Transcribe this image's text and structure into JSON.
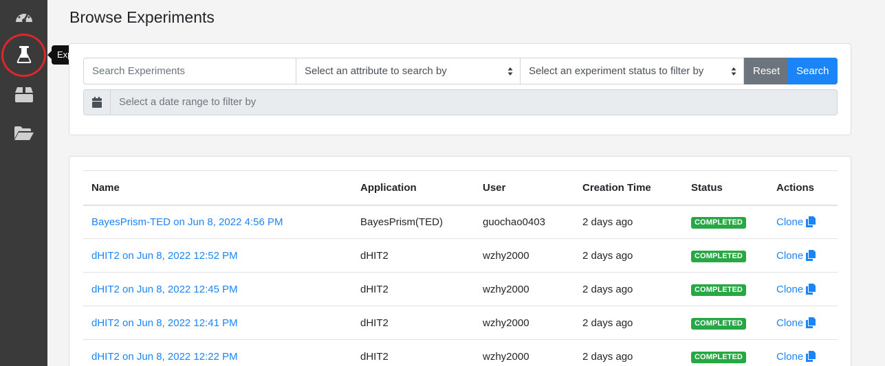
{
  "sidebar": {
    "items": [
      {
        "icon": "dashboard-gauge-icon"
      },
      {
        "icon": "flask-icon",
        "active": true
      },
      {
        "icon": "box-icon"
      },
      {
        "icon": "folder-open-icon"
      }
    ],
    "tooltip": "Experiments"
  },
  "page": {
    "title": "Browse Experiments"
  },
  "filters": {
    "search_placeholder": "Search Experiments",
    "attribute_select": "Select an attribute to search by",
    "status_select": "Select an experiment status to filter by",
    "reset_label": "Reset",
    "search_label": "Search",
    "date_placeholder": "Select a date range to filter by"
  },
  "table": {
    "headers": {
      "name": "Name",
      "application": "Application",
      "user": "User",
      "creation_time": "Creation Time",
      "status": "Status",
      "actions": "Actions"
    },
    "rows": [
      {
        "name": "BayesPrism-TED on Jun 8, 2022 4:56 PM",
        "application": "BayesPrism(TED)",
        "user": "guochao0403",
        "created": "2 days ago",
        "status": "COMPLETED",
        "action": "Clone"
      },
      {
        "name": "dHIT2 on Jun 8, 2022 12:52 PM",
        "application": "dHIT2",
        "user": "wzhy2000",
        "created": "2 days ago",
        "status": "COMPLETED",
        "action": "Clone"
      },
      {
        "name": "dHIT2 on Jun 8, 2022 12:45 PM",
        "application": "dHIT2",
        "user": "wzhy2000",
        "created": "2 days ago",
        "status": "COMPLETED",
        "action": "Clone"
      },
      {
        "name": "dHIT2 on Jun 8, 2022 12:41 PM",
        "application": "dHIT2",
        "user": "wzhy2000",
        "created": "2 days ago",
        "status": "COMPLETED",
        "action": "Clone"
      },
      {
        "name": "dHIT2 on Jun 8, 2022 12:22 PM",
        "application": "dHIT2",
        "user": "wzhy2000",
        "created": "2 days ago",
        "status": "COMPLETED",
        "action": "Clone"
      }
    ]
  },
  "colors": {
    "sidebar_bg": "#3a3a3a",
    "accent_blue": "#1b84f7",
    "status_green": "#28a745",
    "highlight_ring": "#e0262b",
    "reset_gray": "#6c757d"
  }
}
